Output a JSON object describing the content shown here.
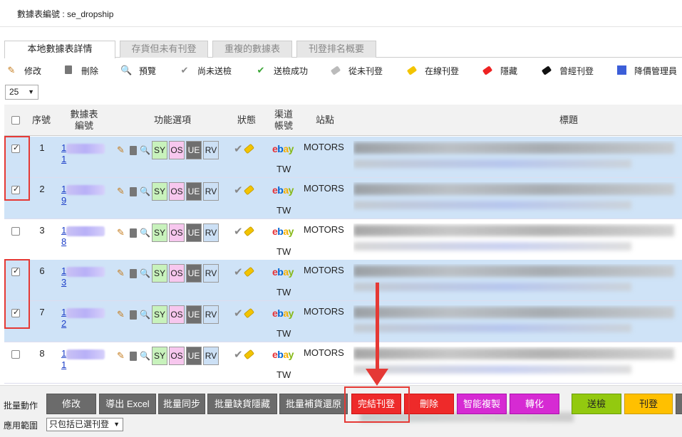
{
  "header": {
    "label": "數據表編號",
    "separator": " : ",
    "value": "se_dropship"
  },
  "tabs": [
    {
      "label": "本地數據表詳情",
      "active": true
    },
    {
      "label": "存貨但未有刊登",
      "active": false
    },
    {
      "label": "重複的數據表",
      "active": false
    },
    {
      "label": "刊登排名概要",
      "active": false
    }
  ],
  "legend": [
    {
      "icon": "pencil-icon",
      "label": "修改"
    },
    {
      "icon": "trash-icon",
      "label": "刪除"
    },
    {
      "icon": "magnifier-icon",
      "label": "預覽"
    },
    {
      "icon": "gray-check-icon",
      "label": "尚未送檢"
    },
    {
      "icon": "green-check-icon",
      "label": "送檢成功"
    },
    {
      "icon": "gray-tag-icon",
      "label": "從未刊登"
    },
    {
      "icon": "yellow-tag-icon",
      "label": "在線刊登"
    },
    {
      "icon": "red-tag-icon",
      "label": "隱藏"
    },
    {
      "icon": "black-tag-icon",
      "label": "曾經刊登"
    },
    {
      "icon": "blue-square-icon",
      "label": "降價管理員"
    }
  ],
  "page_size": "25",
  "columns": {
    "seq": "序號",
    "sku_line1": "數據表",
    "sku_line2": "編號",
    "functions": "功能選項",
    "status": "狀態",
    "channel_line1": "渠道",
    "channel_line2": "帳號",
    "site": "站點",
    "title": "標題"
  },
  "func_buttons": {
    "sy": "SY",
    "os": "OS",
    "ue": "UE",
    "rv": "RV"
  },
  "rows": [
    {
      "seq": "1",
      "sku_start": "1",
      "sku_end": "1",
      "checked": true,
      "channel": "TW",
      "site": "MOTORS"
    },
    {
      "seq": "2",
      "sku_start": "1",
      "sku_end": "9",
      "checked": true,
      "channel": "TW",
      "site": "MOTORS"
    },
    {
      "seq": "3",
      "sku_start": "1",
      "sku_end": "8",
      "checked": false,
      "channel": "TW",
      "site": "MOTORS"
    },
    {
      "seq": "6",
      "sku_start": "1",
      "sku_end": "3",
      "checked": true,
      "channel": "TW",
      "site": "MOTORS"
    },
    {
      "seq": "7",
      "sku_start": "1",
      "sku_end": "2",
      "checked": true,
      "channel": "TW",
      "site": "MOTORS"
    },
    {
      "seq": "8",
      "sku_start": "1",
      "sku_end": "1",
      "checked": false,
      "channel": "TW",
      "site": "MOTORS"
    }
  ],
  "ebay_logo": {
    "e": "e",
    "b": "b",
    "a": "a",
    "y": "y"
  },
  "bottom": {
    "batch_label": "批量動作",
    "scope_label": "應用範圍",
    "scope_value": "只包括已選刊登",
    "buttons": [
      {
        "label": "修改",
        "style": "gray"
      },
      {
        "label": "導出 Excel",
        "style": "gray"
      },
      {
        "label": "批量同步",
        "style": "gray"
      },
      {
        "label": "批量缺貨隱藏",
        "style": "gray"
      },
      {
        "label": "批量補貨還原",
        "style": "gray"
      },
      {
        "label": "完結刊登",
        "style": "red"
      },
      {
        "label": "刪除",
        "style": "red"
      },
      {
        "label": "智能複製",
        "style": "magenta"
      },
      {
        "label": "轉化",
        "style": "magenta"
      },
      {
        "label": "送檢",
        "style": "green"
      },
      {
        "label": "刊登",
        "style": "yellow"
      }
    ]
  },
  "colors": {
    "selected_row": "#cfe3f7",
    "highlight": "#e53935",
    "link": "#1e40c8"
  }
}
